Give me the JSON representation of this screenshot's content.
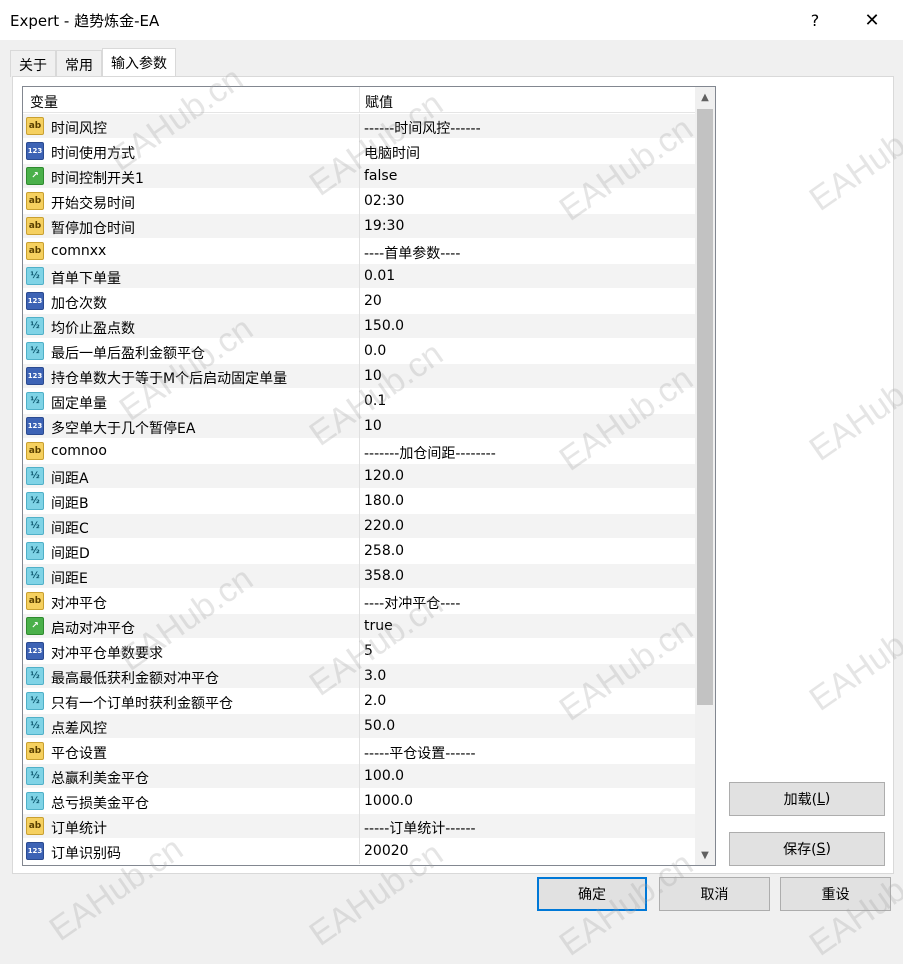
{
  "window": {
    "title": "Expert - 趋势炼金-EA",
    "help": "?",
    "close": "✕"
  },
  "tabs": [
    {
      "label": "关于"
    },
    {
      "label": "常用"
    },
    {
      "label": "输入参数"
    }
  ],
  "grid": {
    "col_variable": "变量",
    "col_value": "赋值",
    "rows": [
      {
        "type": "str",
        "name": "时间风控",
        "value": "------时间风控------"
      },
      {
        "type": "int",
        "name": "时间使用方式",
        "value": "电脑时间"
      },
      {
        "type": "bool",
        "name": "时间控制开关1",
        "value": "false"
      },
      {
        "type": "str",
        "name": "开始交易时间",
        "value": "02:30"
      },
      {
        "type": "str",
        "name": "暂停加仓时间",
        "value": "19:30"
      },
      {
        "type": "str",
        "name": "comnxx",
        "value": "----首单参数----"
      },
      {
        "type": "dbl",
        "name": "首单下单量",
        "value": "0.01"
      },
      {
        "type": "int",
        "name": "加仓次数",
        "value": "20"
      },
      {
        "type": "dbl",
        "name": "均价止盈点数",
        "value": "150.0"
      },
      {
        "type": "dbl",
        "name": "最后一单后盈利金额平仓",
        "value": "0.0"
      },
      {
        "type": "int",
        "name": "持仓单数大于等于M个后启动固定单量",
        "value": "10"
      },
      {
        "type": "dbl",
        "name": "固定单量",
        "value": "0.1"
      },
      {
        "type": "int",
        "name": "多空单大于几个暂停EA",
        "value": "10"
      },
      {
        "type": "str",
        "name": "comnoo",
        "value": "-------加仓间距--------"
      },
      {
        "type": "dbl",
        "name": "间距A",
        "value": "120.0"
      },
      {
        "type": "dbl",
        "name": "间距B",
        "value": "180.0"
      },
      {
        "type": "dbl",
        "name": "间距C",
        "value": "220.0"
      },
      {
        "type": "dbl",
        "name": "间距D",
        "value": "258.0"
      },
      {
        "type": "dbl",
        "name": "间距E",
        "value": "358.0"
      },
      {
        "type": "str",
        "name": "对冲平仓",
        "value": "----对冲平仓----"
      },
      {
        "type": "bool",
        "name": "启动对冲平仓",
        "value": "true"
      },
      {
        "type": "int",
        "name": "对冲平仓单数要求",
        "value": "5"
      },
      {
        "type": "dbl",
        "name": "最高最低获利金额对冲平仓",
        "value": "3.0"
      },
      {
        "type": "dbl",
        "name": "只有一个订单时获利金额平仓",
        "value": "2.0"
      },
      {
        "type": "dbl",
        "name": "点差风控",
        "value": "50.0"
      },
      {
        "type": "str",
        "name": "平仓设置",
        "value": "-----平仓设置------"
      },
      {
        "type": "dbl",
        "name": "总赢利美金平仓",
        "value": "100.0"
      },
      {
        "type": "dbl",
        "name": "总亏损美金平仓",
        "value": "1000.0"
      },
      {
        "type": "str",
        "name": "订单统计",
        "value": "-----订单统计------"
      },
      {
        "type": "int",
        "name": "订单识别码",
        "value": "20020"
      }
    ]
  },
  "icons": {
    "str": "ab",
    "int": "123",
    "dbl": "½",
    "bool": "↗"
  },
  "buttons": {
    "load_text": "加载(",
    "load_key": "L",
    "load_end": ")",
    "save_text": "保存(",
    "save_key": "S",
    "save_end": ")",
    "ok": "确定",
    "cancel": "取消",
    "reset": "重设"
  },
  "watermark": "EAHub.cn"
}
